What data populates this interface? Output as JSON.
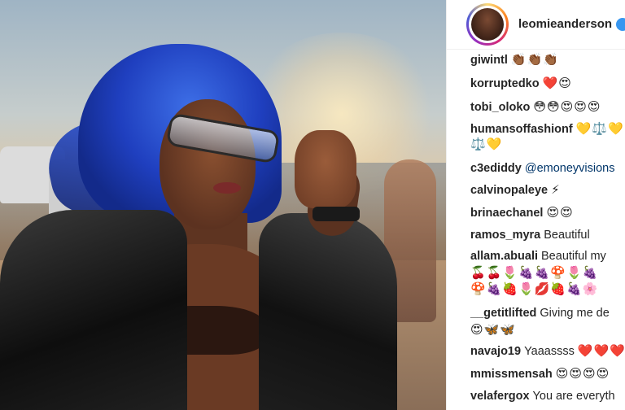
{
  "post": {
    "account": {
      "username": "leomieanderson"
    }
  },
  "comments": [
    {
      "username": "giwintl",
      "text": "",
      "emoji": "👏🏾👏🏾👏🏾"
    },
    {
      "username": "korruptedko",
      "text": "",
      "emoji": "❤️😍"
    },
    {
      "username": "tobi_oloko",
      "text": "",
      "emoji": "😳😳😍😍😍"
    },
    {
      "username": "humansoffashionf",
      "text": "",
      "emoji": "💛⚖️💛"
    },
    {
      "username": "",
      "text": "",
      "emoji": "⚖️💛"
    },
    {
      "username": "c3ediddy",
      "mention": "@emoneyvisions",
      "text": "",
      "emoji": ""
    },
    {
      "username": "calvinopaleye",
      "text": "",
      "emoji": "⚡"
    },
    {
      "username": "brinaechanel",
      "text": "",
      "emoji": "😍😍"
    },
    {
      "username": "ramos_myra",
      "text": "Beautiful",
      "emoji": ""
    },
    {
      "username": "allam.abuali",
      "text": "Beautiful my",
      "emoji": ""
    },
    {
      "username": "",
      "text": "",
      "emoji": "🍒🍒🌷🍇🍇🍄🌷🍇"
    },
    {
      "username": "",
      "text": "",
      "emoji": "🍄🍇🍓🌷💋🍓🍇🌸"
    },
    {
      "username": "__getitlifted",
      "text": "Giving me de",
      "emoji": ""
    },
    {
      "username": "",
      "text": "",
      "emoji": "😍🦋🦋"
    },
    {
      "username": "navajo19",
      "text": "Yaaassss",
      "emoji": "❤️❤️❤️"
    },
    {
      "username": "mmissmensah",
      "text": "",
      "emoji": "😍😍😍😍"
    },
    {
      "username": "velafergox",
      "text": "You are everyth",
      "emoji": ""
    }
  ]
}
